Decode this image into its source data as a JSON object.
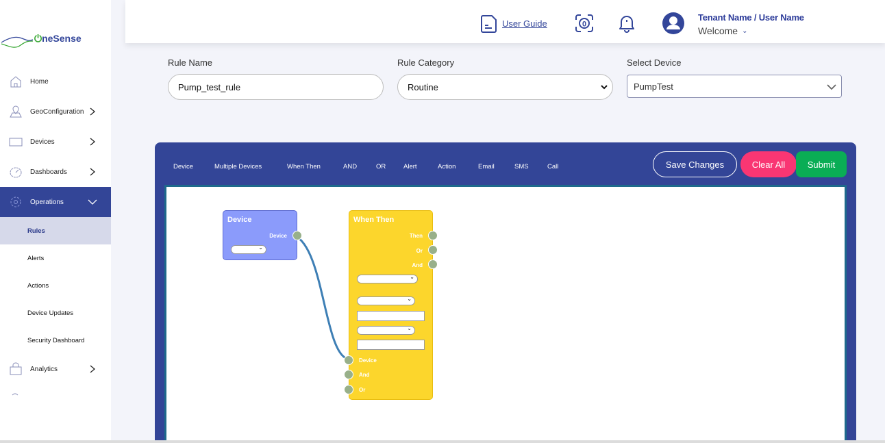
{
  "brand": {
    "name_prefix": "ne",
    "name_suffix": "Sense",
    "power_glyph": "O"
  },
  "sidebar": {
    "items": [
      {
        "label": "Home",
        "icon": "home-icon",
        "has_chevron": false
      },
      {
        "label": "GeoConfiguration",
        "icon": "map-pin-icon",
        "has_chevron": true
      },
      {
        "label": "Devices",
        "icon": "laptop-icon",
        "has_chevron": true
      },
      {
        "label": "Dashboards",
        "icon": "speedometer-icon",
        "has_chevron": true
      },
      {
        "label": "Operations",
        "icon": "gear-icon",
        "has_chevron": true,
        "expanded": true,
        "active": true
      }
    ],
    "sub_items": [
      {
        "label": "Rules",
        "active": true
      },
      {
        "label": "Alerts"
      },
      {
        "label": "Actions"
      },
      {
        "label": "Device Updates"
      },
      {
        "label": "Security Dashboard"
      }
    ],
    "analytics": {
      "label": "Analytics",
      "icon": "shopping-bag-icon",
      "has_chevron": true
    }
  },
  "header": {
    "user_guide": "User Guide",
    "user_name": "Tenant Name / User Name",
    "welcome": "Welcome"
  },
  "form": {
    "rule_name_label": "Rule Name",
    "rule_name_value": "Pump_test_rule",
    "rule_category_label": "Rule Category",
    "rule_category_value": "Routine",
    "select_device_label": "Select Device",
    "select_device_value": "PumpTest"
  },
  "toolbar": {
    "tools": [
      "Device",
      "Multiple Devices",
      "When Then",
      "AND",
      "OR",
      "Alert",
      "Action",
      "Email",
      "SMS",
      "Call"
    ],
    "save_label": "Save Changes",
    "clear_label": "Clear All",
    "submit_label": "Submit"
  },
  "canvas": {
    "device_node": {
      "title": "Device",
      "output_port": "Device"
    },
    "when_then_node": {
      "title": "When Then",
      "output_ports": [
        "Then",
        "Or",
        "And"
      ],
      "input_ports": [
        "Device",
        "And",
        "Or"
      ]
    },
    "colors": {
      "device_node": "#8b9bfb",
      "when_then_node": "#fcd62c",
      "port": "#98b08a",
      "wire": "#3e7fb5"
    }
  },
  "colors": {
    "primary": "#334597",
    "clear": "#f93673",
    "submit": "#0aad55",
    "logo_green": "#3aa835"
  }
}
